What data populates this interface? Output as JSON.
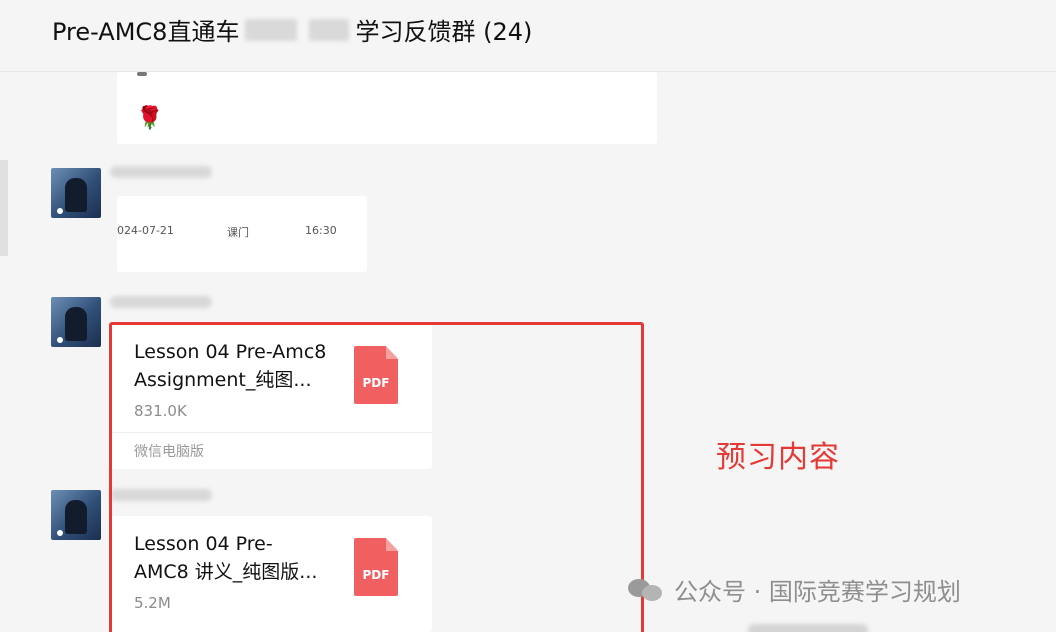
{
  "header": {
    "title_prefix": "Pre-AMC8直通车",
    "title_suffix": "学习反馈群 (24)"
  },
  "chat": {
    "rose_emoji": "🌹",
    "date_message": {
      "date": "024-07-21",
      "place": "课门",
      "time": "16:30"
    },
    "files": [
      {
        "title": "Lesson 04 Pre-Amc8\nAssignment_纯图...",
        "size": "831.0K",
        "icon_label": "PDF",
        "footer": "微信电脑版"
      },
      {
        "title": "Lesson 04 Pre-\nAMC8 讲义_纯图版...",
        "size": "5.2M",
        "icon_label": "PDF"
      }
    ],
    "annotation": "预习内容"
  },
  "watermark": {
    "text": "公众号 · 国际竞赛学习规划"
  },
  "colors": {
    "highlight": "#e53935",
    "pdf": "#f06060",
    "background": "#f5f5f5"
  }
}
